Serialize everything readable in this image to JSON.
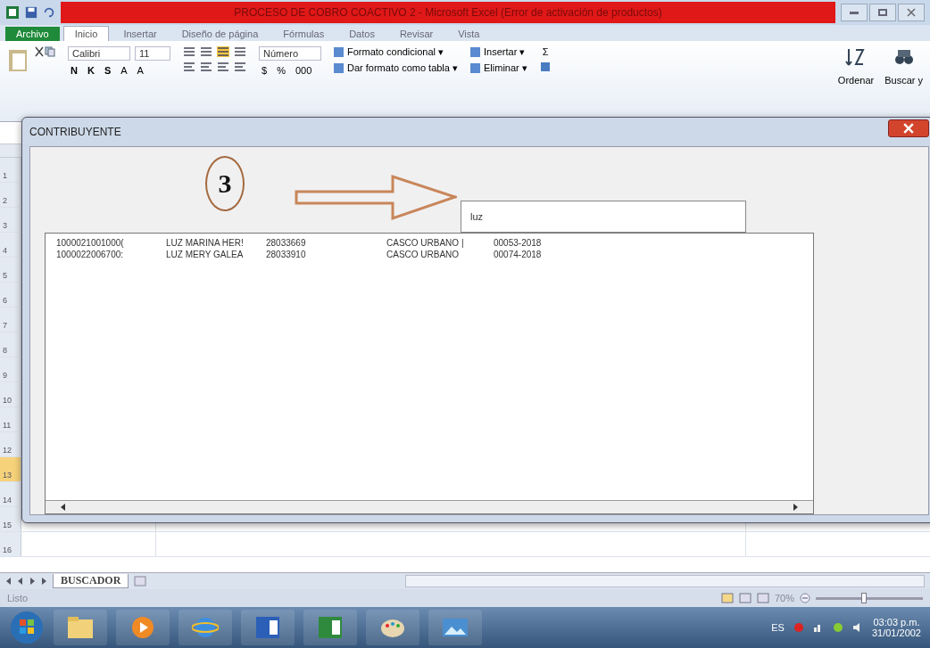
{
  "window": {
    "title": "PROCESO DE COBRO COACTIVO 2 - Microsoft Excel (Error de activación de productos)"
  },
  "ribbon_tabs": [
    {
      "label": "Archivo",
      "selected": false,
      "kind": "file"
    },
    {
      "label": "Inicio",
      "selected": true,
      "kind": "tab"
    },
    {
      "label": "Insertar",
      "selected": false,
      "kind": "tab"
    },
    {
      "label": "Diseño de página",
      "selected": false,
      "kind": "tab"
    },
    {
      "label": "Fórmulas",
      "selected": false,
      "kind": "tab"
    },
    {
      "label": "Datos",
      "selected": false,
      "kind": "tab"
    },
    {
      "label": "Revisar",
      "selected": false,
      "kind": "tab"
    },
    {
      "label": "Vista",
      "selected": false,
      "kind": "tab"
    }
  ],
  "ribbon": {
    "font": "Calibri",
    "font_size": "11",
    "style_buttons": [
      "N",
      "K",
      "S"
    ],
    "size_buttons": [
      "A",
      "A"
    ],
    "number_format": "Número",
    "number_buttons": [
      "$",
      "%",
      "000"
    ],
    "commands": [
      {
        "label": "Formato condicional ▾"
      },
      {
        "label": "Dar formato como tabla ▾"
      }
    ],
    "cell_commands": [
      {
        "label": "Insertar ▾"
      },
      {
        "label": "Eliminar ▾"
      }
    ],
    "sum": "Σ",
    "sort": "Ordenar",
    "find": "Buscar y"
  },
  "sheet": {
    "rows": [
      {
        "label": "1",
        "selected": false
      },
      {
        "label": "2",
        "selected": false
      },
      {
        "label": "3",
        "selected": false
      },
      {
        "label": "4",
        "selected": false
      },
      {
        "label": "5",
        "selected": false
      },
      {
        "label": "6",
        "selected": false
      },
      {
        "label": "7",
        "selected": false
      },
      {
        "label": "8",
        "selected": false
      },
      {
        "label": "9",
        "selected": false
      },
      {
        "label": "10",
        "selected": false
      },
      {
        "label": "11",
        "selected": false
      },
      {
        "label": "12",
        "selected": false
      },
      {
        "label": "13",
        "selected": true
      },
      {
        "label": "14",
        "selected": false
      },
      {
        "label": "15",
        "selected": false
      },
      {
        "label": "16",
        "selected": false
      }
    ],
    "sheet_tabs": [
      {
        "label": "BUSCADOR",
        "selected": true
      }
    ],
    "status": "Listo",
    "zoom": "70%",
    "zoom_slider": {
      "level": 0.45
    }
  },
  "dialog": {
    "title": "CONTRIBUYENTE",
    "annotation": "3",
    "search": {
      "value": "luz"
    },
    "results": [
      {
        "cells": [
          "1000021001000(",
          "LUZ MARINA HER!",
          "28033669",
          "CASCO URBANO |",
          "00053-2018"
        ]
      },
      {
        "cells": [
          "1000022006700:",
          "LUZ MERY GALEA",
          "28033910",
          "CASCO URBANO",
          "00074-2018"
        ]
      }
    ]
  },
  "taskbar": {
    "language": "ES",
    "time": "03:03 p.m.",
    "date": "31/01/2002"
  }
}
